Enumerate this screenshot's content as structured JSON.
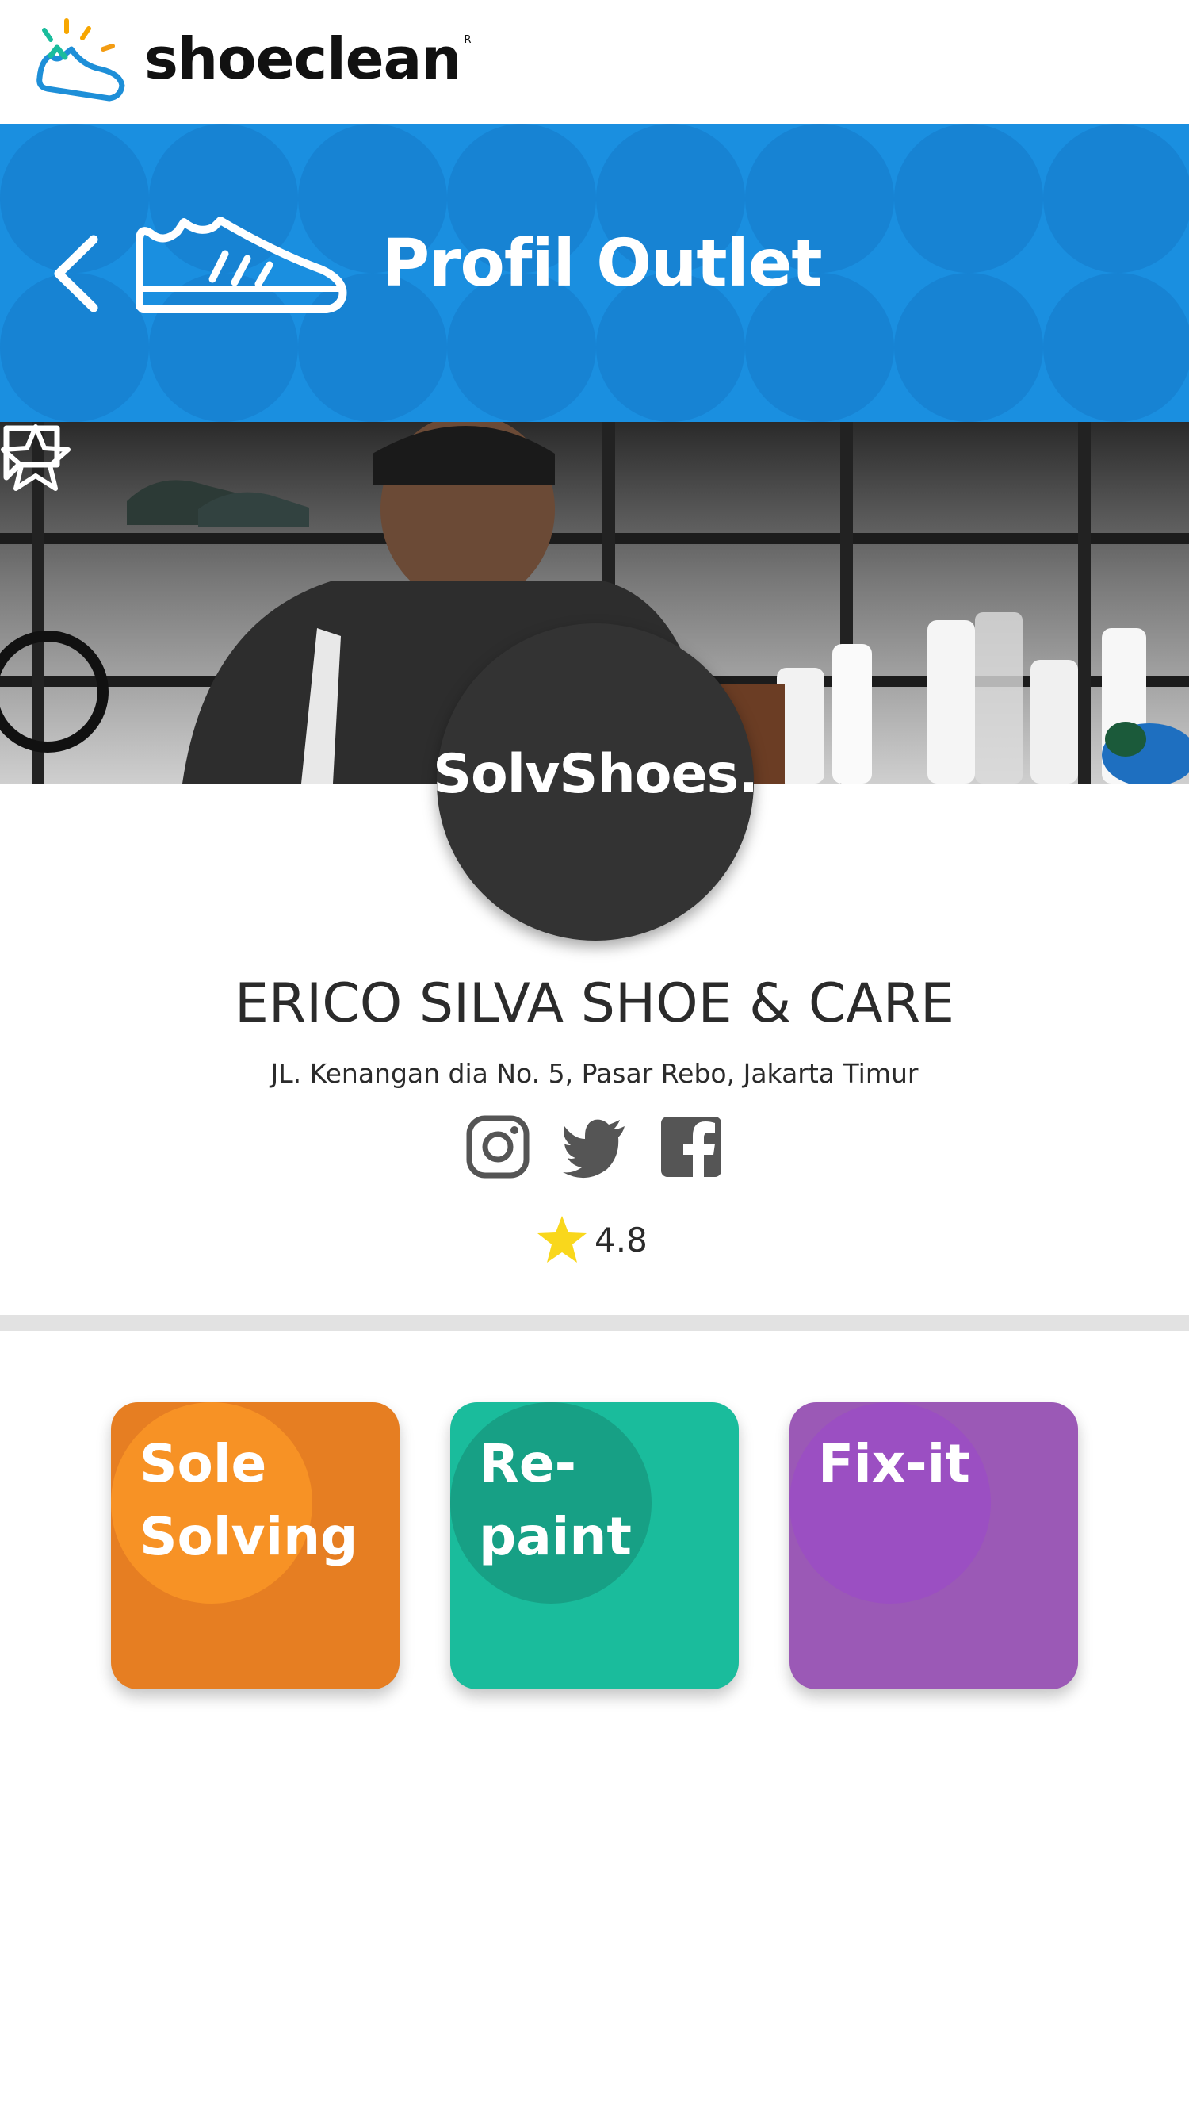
{
  "app": {
    "brand": "shoeclean",
    "reg_mark": "R"
  },
  "header": {
    "title": "Profil Outlet"
  },
  "outlet": {
    "logo_text": "SolvShoes.",
    "name": "ERICO SILVA SHOE & CARE",
    "address": "JL. Kenangan dia No. 5, Pasar Rebo, Jakarta Timur",
    "rating": "4.8",
    "social": [
      "instagram-icon",
      "twitter-icon",
      "facebook-icon"
    ]
  },
  "services": [
    {
      "label": "Sole Solving"
    },
    {
      "label": "Re-paint"
    },
    {
      "label": "Fix-it"
    }
  ],
  "colors": {
    "banner": "#1a8fe0",
    "sole_solving": "#e67e22",
    "repaint": "#1abc9c",
    "fix_it": "#9b59b6",
    "rating_star": "#f9d71c",
    "social_icons": "#555555"
  }
}
